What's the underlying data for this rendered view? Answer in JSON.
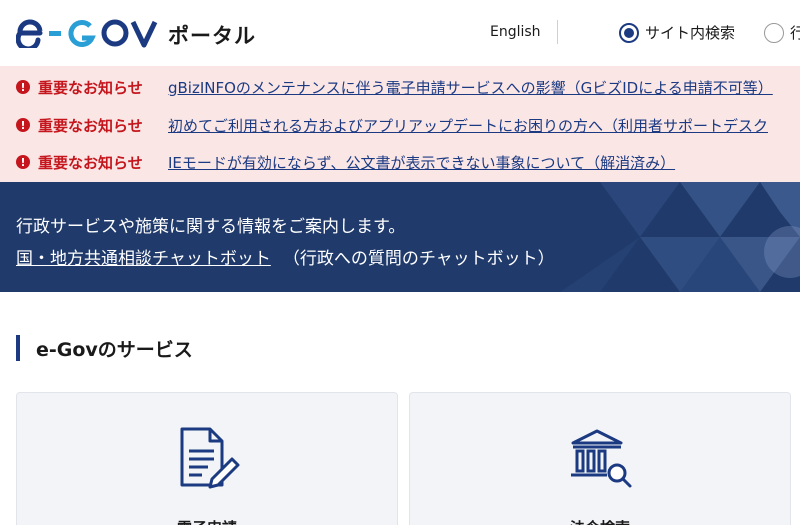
{
  "header": {
    "logo_text": "e-GOV",
    "logo_subtitle": "ポータル",
    "language_link": "English",
    "search_scope": {
      "selected": "サイト内検索",
      "options": [
        "サイト内検索",
        "行"
      ]
    }
  },
  "notices": [
    {
      "tag": "重要なお知らせ",
      "message": "gBizINFOのメンテナンスに伴う電子申請サービスへの影響（GビズIDによる申請不可等）"
    },
    {
      "tag": "重要なお知らせ",
      "message": "初めてご利用される方およびアプリアップデートにお困りの方へ（利用者サポートデスク"
    },
    {
      "tag": "重要なお知らせ",
      "message": "IEモードが有効にならず、公文書が表示できない事象について（解消済み）"
    }
  ],
  "banner": {
    "intro": "行政サービスや施策に関する情報をご案内します。",
    "chatbot_link": "国・地方共通相談チャットボット",
    "chatbot_note": "（行政への質問のチャットボット）"
  },
  "services": {
    "title": "e-Govのサービス",
    "cards": [
      {
        "label": "電子申請",
        "icon": "document-edit-icon"
      },
      {
        "label": "法令検索",
        "icon": "law-building-search-icon"
      }
    ]
  },
  "colors": {
    "brand_navy": "#1b3a82",
    "logo_light_blue": "#2a9fd6",
    "alert_red": "#c4161c",
    "notice_bg": "#fbe6e6",
    "banner_bg": "#1f3a6b"
  }
}
